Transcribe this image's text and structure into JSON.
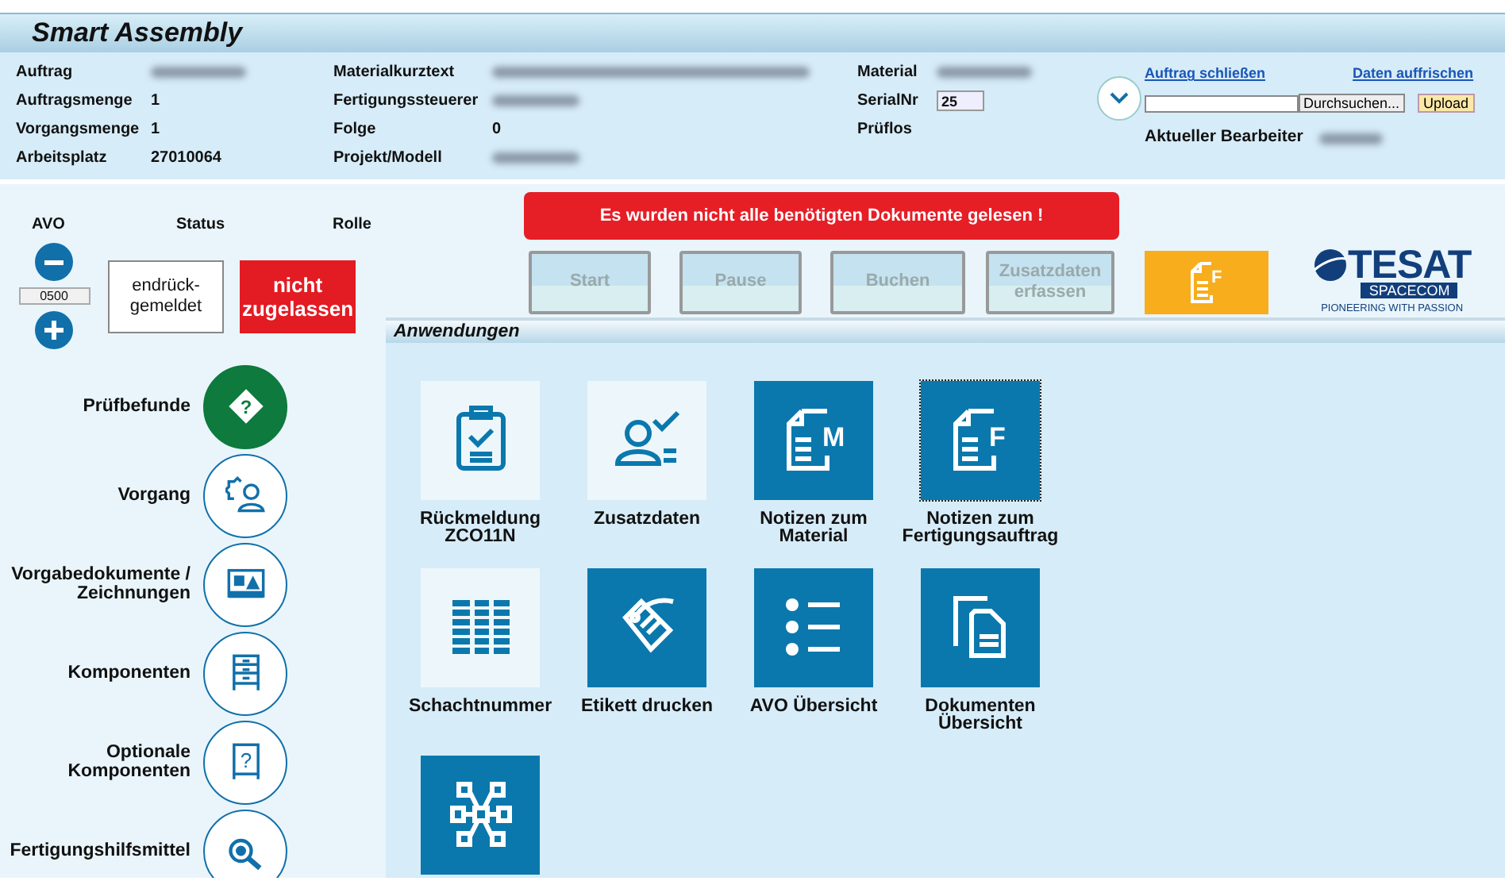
{
  "app_title": "Smart Assembly",
  "info_columns": [
    {
      "fields": [
        {
          "label": "Auftrag",
          "redacted": true
        },
        {
          "label": "Auftragsmenge",
          "value": "1"
        },
        {
          "label": "Vorgangsmenge",
          "value": "1"
        },
        {
          "label": "Arbeitsplatz",
          "value": "27010064"
        }
      ]
    },
    {
      "fields": [
        {
          "label": "Materialkurztext",
          "redacted": true
        },
        {
          "label": "Fertigungssteuerer",
          "redacted": true
        },
        {
          "label": "Folge",
          "value": "0"
        },
        {
          "label": "Projekt/Modell",
          "redacted": true
        }
      ]
    },
    {
      "fields": [
        {
          "label": "Material",
          "redacted": true
        },
        {
          "label": "SerialNr",
          "input": "25"
        },
        {
          "label": "Prüflos"
        }
      ]
    }
  ],
  "links": [
    "Auftrag schließen",
    "Daten auffrischen"
  ],
  "upload": {
    "browse": "Durchsuchen...",
    "button": "Upload"
  },
  "editor": {
    "label": "Aktueller Bearbeiter",
    "redacted": true
  },
  "avo": {
    "headers": [
      "AVO",
      "Status",
      "Rolle"
    ],
    "value": "0500",
    "status": "endrück-gemeldet",
    "role": "nicht zugelassen"
  },
  "message": "Es wurden nicht alle benötigten Dokumente gelesen !",
  "actions": [
    {
      "label": "Start",
      "disabled": true
    },
    {
      "label": "Pause",
      "disabled": true
    },
    {
      "label": "Buchen",
      "disabled": true
    },
    {
      "label": "Zusatzdaten erfassen",
      "disabled": true
    }
  ],
  "logo": {
    "name": "TESAT",
    "sub": "SPACECOM",
    "tagline": "PIONEERING WITH PASSION"
  },
  "doc_button": {
    "letter": "F"
  },
  "menu": [
    {
      "label": "Prüfbefunde",
      "filled": true,
      "icon_text": "?"
    },
    {
      "label": "Vorgang",
      "filled": false
    },
    {
      "label": "Vorgabedokumente / Zeichnungen",
      "filled": false
    },
    {
      "label": "Komponenten",
      "filled": false
    },
    {
      "label": "Optionale Komponenten",
      "filled": false,
      "icon_text": "?"
    },
    {
      "label": "Fertigungshilfsmittel",
      "filled": false
    }
  ],
  "section_title": "Anwendungen",
  "tiles": [
    {
      "label": "Rückmeldung ZCO11N",
      "kind": "light",
      "selected": false
    },
    {
      "label": "Zusatzdaten",
      "kind": "light",
      "selected": false
    },
    {
      "label": "Notizen zum Material",
      "kind": "dark",
      "selected": false,
      "icon_text": "M"
    },
    {
      "label": "Notizen zum Fertigungsauftrag",
      "kind": "dark",
      "selected": true,
      "icon_text": "F"
    },
    {
      "label": "Schachtnummer",
      "kind": "light",
      "selected": false
    },
    {
      "label": "Etikett drucken",
      "kind": "dark",
      "selected": false
    },
    {
      "label": "AVO Übersicht",
      "kind": "dark",
      "selected": false
    },
    {
      "label": "Dokumenten Übersicht",
      "kind": "dark",
      "selected": false
    },
    {
      "kind": "dark",
      "selected": false
    }
  ]
}
